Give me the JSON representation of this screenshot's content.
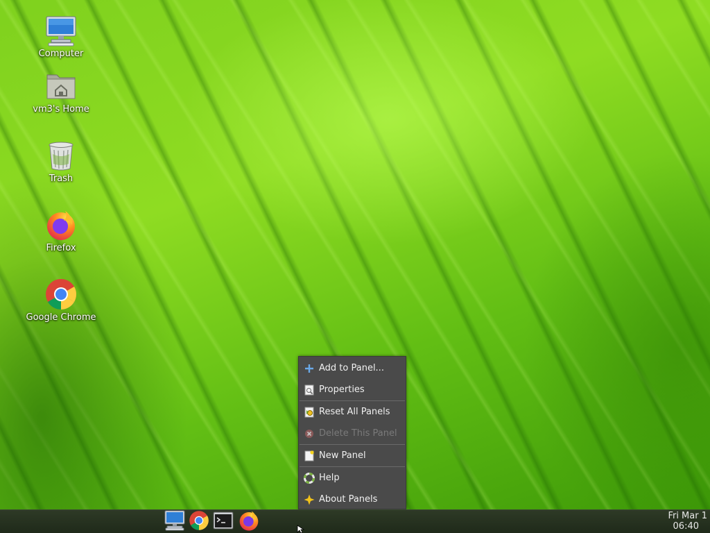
{
  "desktop": {
    "icons": [
      {
        "label": "Computer",
        "icon": "computer-icon"
      },
      {
        "label": "vm3's Home",
        "icon": "home-folder-icon"
      },
      {
        "label": "Trash",
        "icon": "trash-icon"
      },
      {
        "label": "Firefox",
        "icon": "firefox-icon"
      },
      {
        "label": "Google Chrome",
        "icon": "chrome-icon"
      }
    ]
  },
  "context_menu": {
    "items": [
      {
        "label": "Add to Panel...",
        "icon": "add-icon",
        "enabled": true
      },
      {
        "label": "Properties",
        "icon": "properties-icon",
        "enabled": true
      },
      {
        "label": "Reset All Panels",
        "icon": "reset-icon",
        "enabled": true
      },
      {
        "label": "Delete This Panel",
        "icon": "delete-icon",
        "enabled": false
      },
      {
        "label": "New Panel",
        "icon": "new-panel-icon",
        "enabled": true
      },
      {
        "label": "Help",
        "icon": "help-icon",
        "enabled": true
      },
      {
        "label": "About Panels",
        "icon": "about-icon",
        "enabled": true
      }
    ]
  },
  "panel": {
    "launchers": [
      {
        "name": "computer-launcher",
        "icon": "computer-icon"
      },
      {
        "name": "chrome-launcher",
        "icon": "chrome-icon"
      },
      {
        "name": "terminal-launcher",
        "icon": "terminal-icon"
      },
      {
        "name": "firefox-launcher",
        "icon": "firefox-icon"
      }
    ],
    "clock": {
      "date": "Fri Mar 1",
      "time": "06:40"
    }
  },
  "colors": {
    "menu_bg": "#4a4a4a",
    "panel_bg": "#253021",
    "wallpaper": "#7fd11e"
  }
}
